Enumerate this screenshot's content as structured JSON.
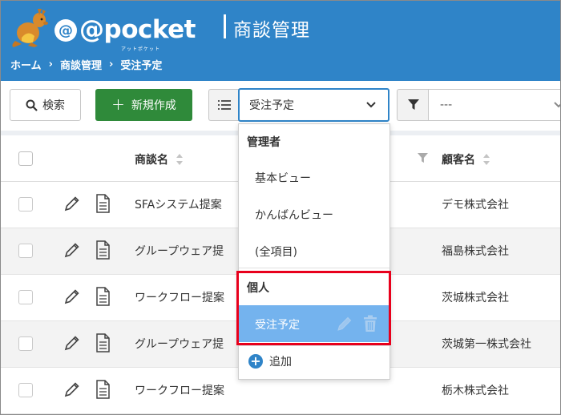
{
  "header": {
    "logo_text": "@pocket",
    "logo_sub": "アットポケット",
    "page_title": "商談管理",
    "breadcrumb": [
      "ホーム",
      "商談管理",
      "受注予定"
    ]
  },
  "toolbar": {
    "search_label": "検索",
    "new_label": "新規作成",
    "view_selected": "受注予定",
    "filter_value": "---"
  },
  "table": {
    "col_name": "商談名",
    "col_customer": "顧客名",
    "rows": [
      {
        "name": "SFAシステム提案",
        "customer": "デモ株式会社"
      },
      {
        "name": "グループウェア提",
        "customer": "福島株式会社"
      },
      {
        "name": "ワークフロー提案",
        "customer": "茨城株式会社"
      },
      {
        "name": "グループウェア提",
        "customer": "茨城第一株式会社"
      },
      {
        "name": "ワークフロー提案",
        "customer": "栃木株式会社"
      }
    ]
  },
  "dropdown": {
    "group_admin": "管理者",
    "admin_items": [
      "基本ビュー",
      "かんばんビュー",
      "(全項目)"
    ],
    "group_personal": "個人",
    "personal_selected": "受注予定",
    "add_label": "追加"
  },
  "colors": {
    "header_bg": "#2f84c8",
    "new_button": "#2f8a3a",
    "selected_item": "#74b3ee",
    "highlight": "#e8001c"
  }
}
